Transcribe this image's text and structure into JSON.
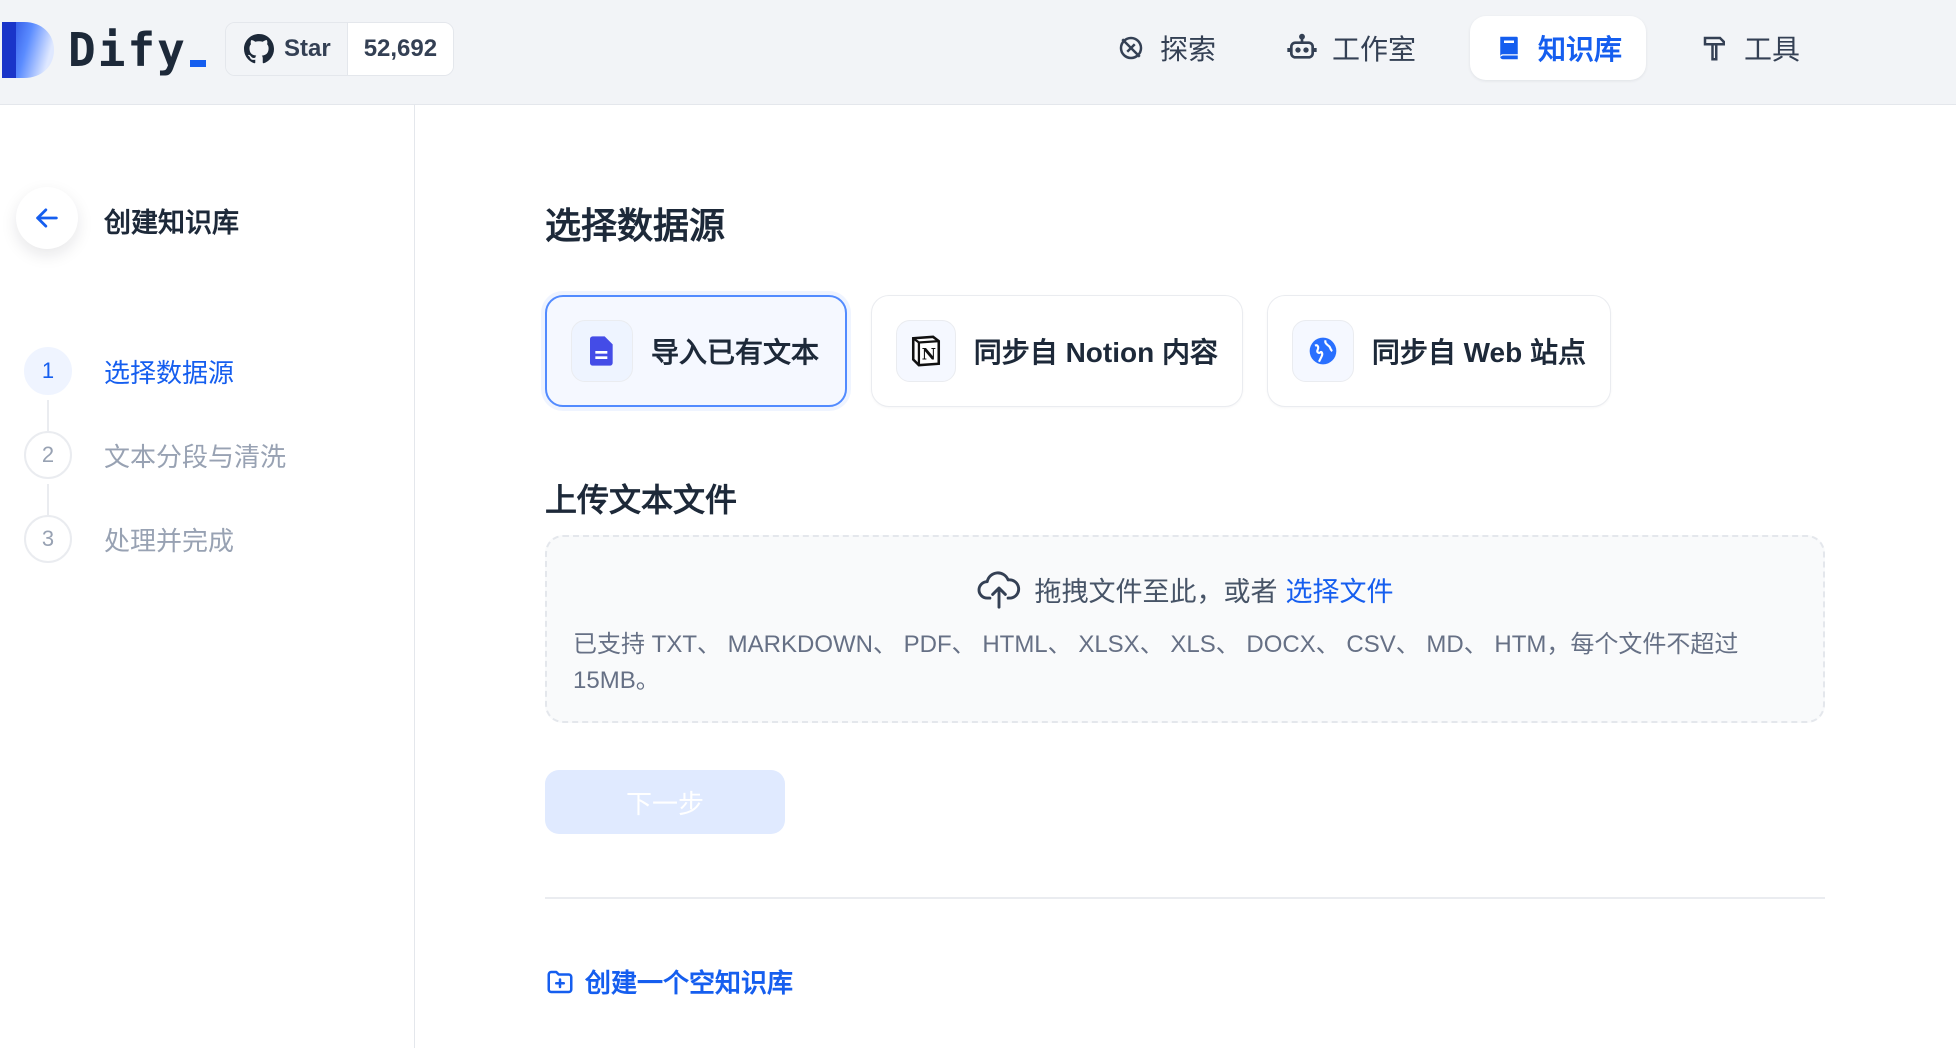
{
  "header": {
    "logo_text": "Dify",
    "github": {
      "star_label": "Star",
      "count": "52,692"
    },
    "nav": [
      {
        "label": "探索",
        "icon": "explore-icon",
        "active": false
      },
      {
        "label": "工作室",
        "icon": "robot-icon",
        "active": false
      },
      {
        "label": "知识库",
        "icon": "book-icon",
        "active": true
      },
      {
        "label": "工具",
        "icon": "hammer-icon",
        "active": false
      }
    ]
  },
  "sidebar": {
    "title": "创建知识库",
    "steps": [
      {
        "num": "1",
        "label": "选择数据源",
        "active": true
      },
      {
        "num": "2",
        "label": "文本分段与清洗",
        "active": false
      },
      {
        "num": "3",
        "label": "处理并完成",
        "active": false
      }
    ]
  },
  "main": {
    "title": "选择数据源",
    "sources": [
      {
        "label": "导入已有文本",
        "icon": "file-icon",
        "active": true
      },
      {
        "label": "同步自 Notion 内容",
        "icon": "notion-icon",
        "active": false
      },
      {
        "label": "同步自 Web 站点",
        "icon": "globe-icon",
        "active": false
      }
    ],
    "upload_title": "上传文本文件",
    "drop_text": "拖拽文件至此，或者",
    "drop_link": "选择文件",
    "drop_hint": "已支持 TXT、 MARKDOWN、 PDF、 HTML、 XLSX、 XLS、 DOCX、 CSV、 MD、 HTM，每个文件不超过 15MB。",
    "next_label": "下一步",
    "empty_kb_label": "创建一个空知识库"
  },
  "colors": {
    "accent": "#155eef",
    "header_bg": "#f2f4f7",
    "next_disabled_bg": "#e0eaff"
  }
}
